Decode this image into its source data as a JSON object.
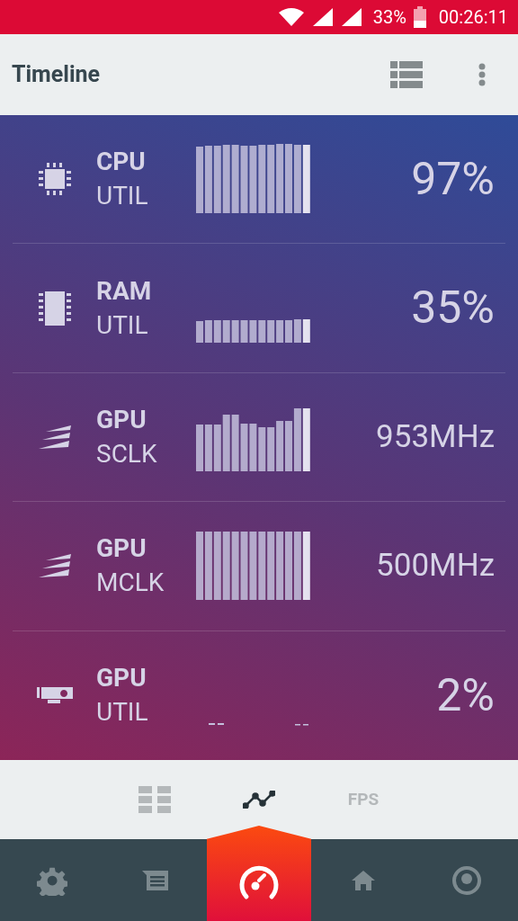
{
  "status_bar": {
    "battery": "33%",
    "time": "00:26:11"
  },
  "app_bar": {
    "title": "Timeline"
  },
  "metrics": [
    {
      "kind": "cpu",
      "name": "CPU",
      "sub": "UTIL",
      "value": "97%"
    },
    {
      "kind": "ram",
      "name": "RAM",
      "sub": "UTIL",
      "value": "35%"
    },
    {
      "kind": "clock",
      "name": "GPU",
      "sub": "SCLK",
      "value": "953MHz"
    },
    {
      "kind": "clock",
      "name": "GPU",
      "sub": "MCLK",
      "value": "500MHz"
    },
    {
      "kind": "gpu",
      "name": "GPU",
      "sub": "UTIL",
      "value": "2%"
    }
  ],
  "view_tabs": [
    {
      "kind": "grid",
      "selected": false
    },
    {
      "kind": "chart",
      "selected": true
    },
    {
      "kind": "text",
      "label": "FPS",
      "selected": false
    }
  ],
  "bottom_nav": [
    {
      "kind": "settings",
      "selected": false
    },
    {
      "kind": "message",
      "selected": false
    },
    {
      "kind": "gauge",
      "selected": true
    },
    {
      "kind": "home",
      "selected": false
    },
    {
      "kind": "profile",
      "selected": false
    }
  ]
}
